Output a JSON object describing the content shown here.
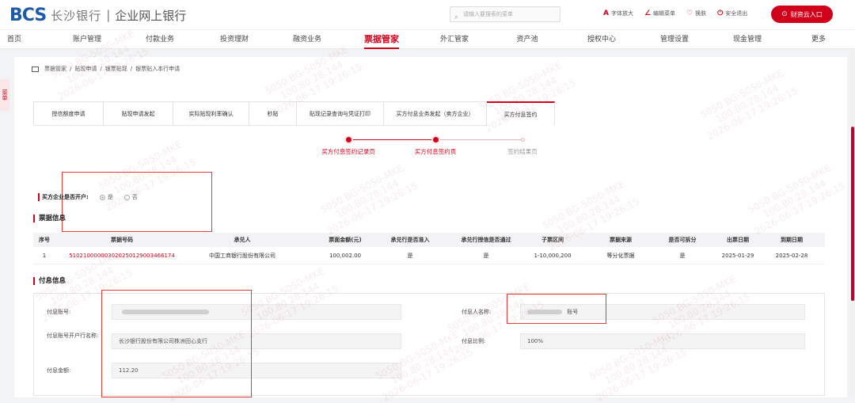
{
  "header": {
    "logo_text": "BCS",
    "bank_name": "长沙银行",
    "separator": "|",
    "system_name": "企业网上银行",
    "search_placeholder": "请输入要搜索的菜单",
    "tools": [
      {
        "icon": "font-size-icon",
        "glyph": "A",
        "label": "字体放大"
      },
      {
        "icon": "edit-menu-icon",
        "glyph": "∠",
        "label": "编辑菜单"
      },
      {
        "icon": "skin-icon",
        "glyph": "♡",
        "label": "换肤"
      },
      {
        "icon": "power-icon",
        "glyph": "⏻",
        "label": "安全退出"
      }
    ],
    "cloud_button": "财资云入口"
  },
  "nav": {
    "items": [
      "首页",
      "账户管理",
      "付款业务",
      "投资理财",
      "融资业务",
      "票据管家",
      "外汇管家",
      "资产池",
      "授权中心",
      "管理设置",
      "现金管理",
      "更多"
    ],
    "active_index": 5
  },
  "side_tab": "菜单",
  "breadcrumb": [
    "票据管家",
    "贴现申请",
    "银票贴现",
    "银票贴入本行申请"
  ],
  "tabs": [
    {
      "label": "授信额度申请",
      "active": false
    },
    {
      "label": "贴现申请发起",
      "active": false
    },
    {
      "label": "实际贴现利率确认",
      "active": false
    },
    {
      "label": "秒贴",
      "active": false
    },
    {
      "label": "贴现记录查询与凭证打印",
      "active": false
    },
    {
      "label": "买方付息业务发起（卖方企业）",
      "active": false
    },
    {
      "label": "买方付息签约",
      "active": true
    }
  ],
  "steps": [
    {
      "label": "买方付息签约记录页",
      "state": "done"
    },
    {
      "label": "买方付息签约页",
      "state": "current"
    },
    {
      "label": "签约结果页",
      "state": "pending"
    }
  ],
  "buyer_account": {
    "label": "买方企业是否开户:",
    "options": [
      {
        "label": "是",
        "selected": true
      },
      {
        "label": "否",
        "selected": false
      }
    ]
  },
  "bill_info": {
    "title": "票据信息",
    "columns": [
      "序号",
      "票据号码",
      "承兑人",
      "票面金额(元)",
      "承兑行是否准入",
      "承兑行授信是否通过",
      "子票区间",
      "票据来源",
      "是否可拆分",
      "出票日期",
      "到期日期"
    ],
    "rows": [
      [
        "1",
        "510210000003020250129003466174",
        "中国工商银行股份有限公司",
        "100,002.00",
        "是",
        "是",
        "1-10,000,200",
        "等分化票据",
        "是",
        "2025-01-29",
        "2025-02-28"
      ]
    ]
  },
  "payment_info": {
    "title": "付息信息",
    "fields": {
      "account_label": "付息账号:",
      "account_value": "",
      "payer_name_label": "付息人名称:",
      "payer_name_value": "账号",
      "bank_label": "付息账号开户行名称:",
      "bank_value": "长沙银行股份有限公司株洲田心支行",
      "ratio_label": "付息比例:",
      "ratio_value": "100%",
      "amount_label": "付息金额:",
      "amount_value": "112.20"
    }
  },
  "watermark": {
    "lines": [
      "5050 BG-5050-MKE",
      "100.80.28.144",
      "2026-06-17 19:26:15"
    ]
  },
  "colors": {
    "brand_red": "#d0021b",
    "brand_blue": "#1e5aa8",
    "highlight_box": "#e53935"
  }
}
